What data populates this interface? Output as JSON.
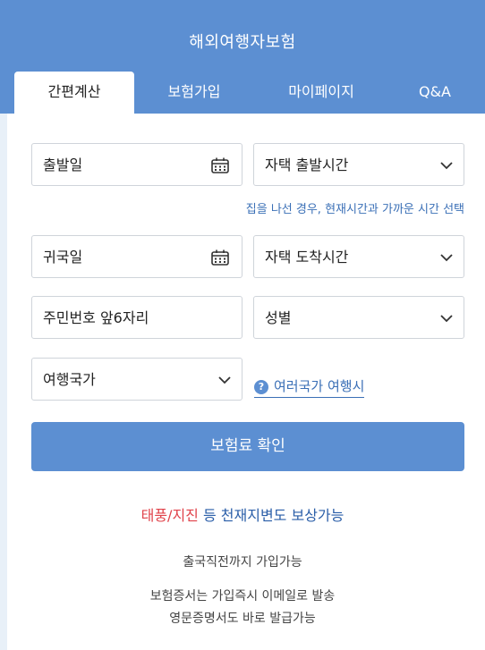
{
  "header": {
    "title": "해외여행자보험",
    "tabs": [
      {
        "label": "간편계산",
        "active": true
      },
      {
        "label": "보험가입",
        "active": false
      },
      {
        "label": "마이페이지",
        "active": false
      },
      {
        "label": "Q&A",
        "active": false
      }
    ]
  },
  "form": {
    "departure_date": "출발일",
    "departure_time": "자택 출발시간",
    "departure_hint": "집을 나선 경우, 현재시간과 가까운 시간 선택",
    "return_date": "귀국일",
    "arrival_time": "자택 도착시간",
    "resident_number": "주민번호 앞6자리",
    "gender": "성별",
    "country": "여행국가",
    "multi_country_icon": "?",
    "multi_country": "여러국가 여행시"
  },
  "submit_label": "보험료 확인",
  "promo": {
    "highlight": "태풍/지진",
    "conjunction": " 등 ",
    "rest": "천재지변도 보상가능"
  },
  "notes": {
    "line1": "출국직전까지 가입가능",
    "line2": "보험증서는 가입즉시 이메일로 발송",
    "line3": "영문증명서도 바로 발급가능"
  },
  "colors": {
    "primary": "#5c8fd2",
    "link": "#3a6fb6",
    "alert": "#e0424a"
  }
}
